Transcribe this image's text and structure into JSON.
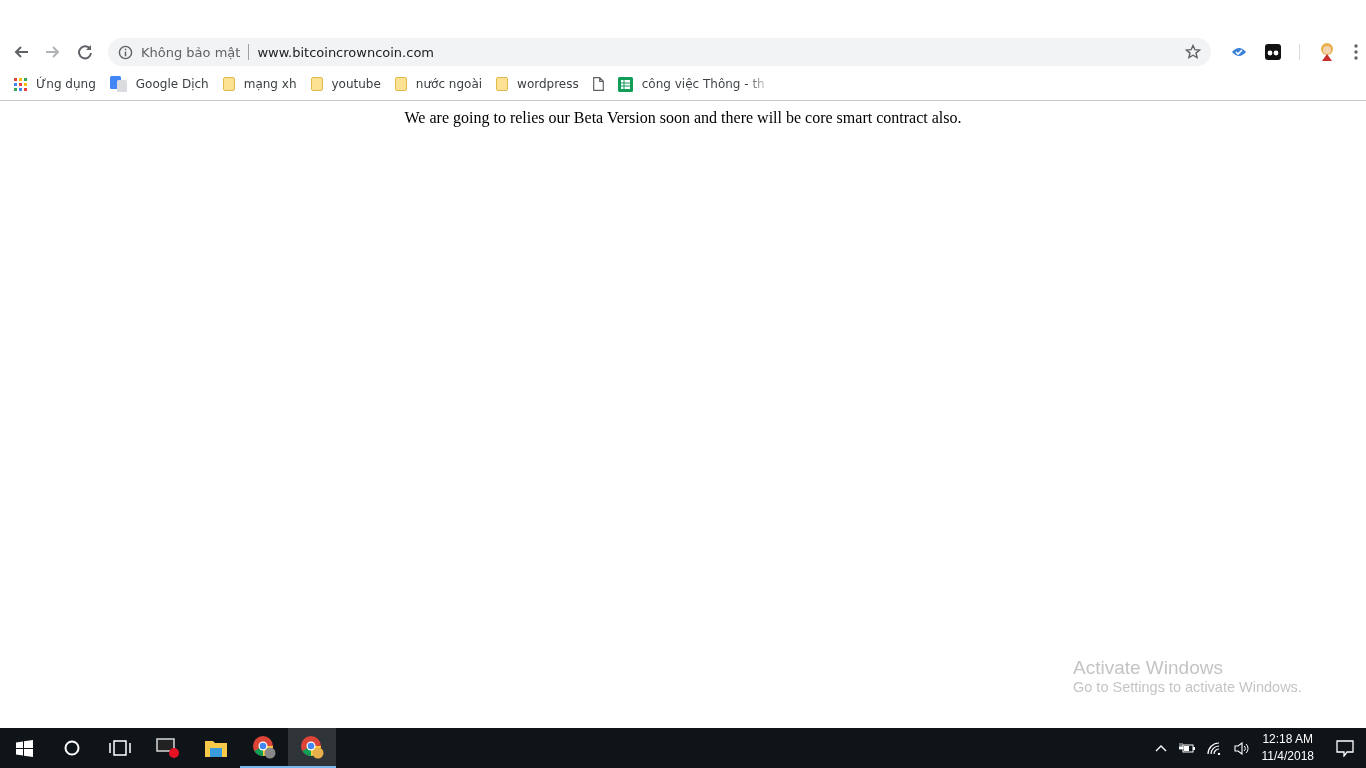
{
  "omnibox": {
    "security": "Không bảo mật",
    "url": "www.bitcoincrowncoin.com"
  },
  "bookmarks": [
    {
      "kind": "apps",
      "label": "Ứng dụng"
    },
    {
      "kind": "translate",
      "label": "Google Dịch"
    },
    {
      "kind": "folder",
      "label": "mạng xh"
    },
    {
      "kind": "folder",
      "label": "youtube"
    },
    {
      "kind": "folder",
      "label": "nước ngoài"
    },
    {
      "kind": "folder",
      "label": "wordpress"
    },
    {
      "kind": "page"
    },
    {
      "kind": "sheet",
      "label": "công việc Thông - th"
    }
  ],
  "page": {
    "message": "We are going to relies our Beta Version soon and there will be core smart contract also."
  },
  "activation": {
    "title": "Activate Windows",
    "hint": "Go to Settings to activate Windows."
  },
  "taskbar": {
    "apps": [
      {
        "kind": "recorder",
        "running": false,
        "selected": false
      },
      {
        "kind": "explorer",
        "running": false,
        "selected": false
      },
      {
        "kind": "chrome",
        "running": true,
        "selected": false
      },
      {
        "kind": "chrome",
        "running": true,
        "selected": true
      }
    ],
    "time": "12:18 AM",
    "date": "11/4/2018"
  }
}
